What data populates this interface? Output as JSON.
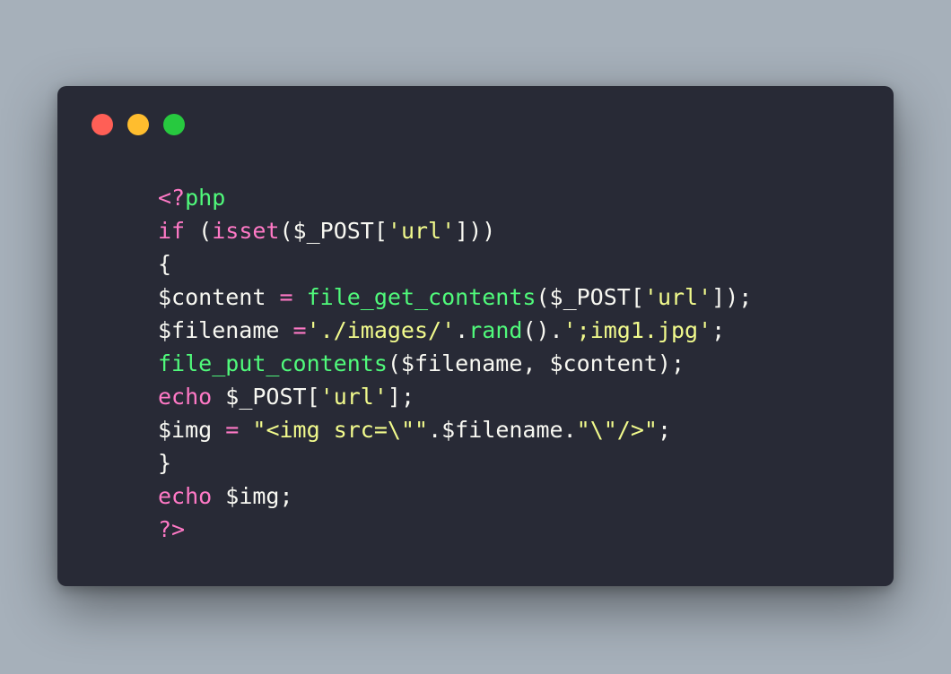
{
  "colors": {
    "background": "#a6b0ba",
    "window": "#282a36",
    "dot_close": "#ff5f56",
    "dot_minimize": "#ffbd2e",
    "dot_maximize": "#27c93f",
    "default": "#f8f8f2",
    "keyword": "#ff79c6",
    "function": "#50fa7b",
    "string": "#f1fa8c"
  },
  "window_controls": [
    "close-dot",
    "minimize-dot",
    "maximize-dot"
  ],
  "code_lines": [
    [
      {
        "t": "<?",
        "c": "keyword"
      },
      {
        "t": "php",
        "c": "function"
      }
    ],
    [
      {
        "t": "if",
        "c": "keyword"
      },
      {
        "t": " (",
        "c": "default"
      },
      {
        "t": "isset",
        "c": "keyword"
      },
      {
        "t": "($_POST[",
        "c": "default"
      },
      {
        "t": "'url'",
        "c": "string"
      },
      {
        "t": "]))",
        "c": "default"
      }
    ],
    [
      {
        "t": "{",
        "c": "default"
      }
    ],
    [
      {
        "t": "$content ",
        "c": "default"
      },
      {
        "t": "=",
        "c": "keyword"
      },
      {
        "t": " ",
        "c": "default"
      },
      {
        "t": "file_get_contents",
        "c": "function"
      },
      {
        "t": "($_POST[",
        "c": "default"
      },
      {
        "t": "'url'",
        "c": "string"
      },
      {
        "t": "]);",
        "c": "default"
      }
    ],
    [
      {
        "t": "$filename ",
        "c": "default"
      },
      {
        "t": "=",
        "c": "keyword"
      },
      {
        "t": "'./images/'",
        "c": "string"
      },
      {
        "t": ".",
        "c": "default"
      },
      {
        "t": "rand",
        "c": "function"
      },
      {
        "t": "().",
        "c": "default"
      },
      {
        "t": "';img1.jpg'",
        "c": "string"
      },
      {
        "t": ";",
        "c": "default"
      }
    ],
    [
      {
        "t": "file_put_contents",
        "c": "function"
      },
      {
        "t": "($filename, $content);",
        "c": "default"
      }
    ],
    [
      {
        "t": "echo",
        "c": "keyword"
      },
      {
        "t": " $_POST[",
        "c": "default"
      },
      {
        "t": "'url'",
        "c": "string"
      },
      {
        "t": "];",
        "c": "default"
      }
    ],
    [
      {
        "t": "$img ",
        "c": "default"
      },
      {
        "t": "=",
        "c": "keyword"
      },
      {
        "t": " ",
        "c": "default"
      },
      {
        "t": "\"<img src=\\\"\"",
        "c": "string"
      },
      {
        "t": ".$filename.",
        "c": "default"
      },
      {
        "t": "\"\\\"/>\"",
        "c": "string"
      },
      {
        "t": ";",
        "c": "default"
      }
    ],
    [
      {
        "t": "}",
        "c": "default"
      }
    ],
    [
      {
        "t": "echo",
        "c": "keyword"
      },
      {
        "t": " $img;",
        "c": "default"
      }
    ],
    [
      {
        "t": "?>",
        "c": "keyword"
      }
    ]
  ]
}
